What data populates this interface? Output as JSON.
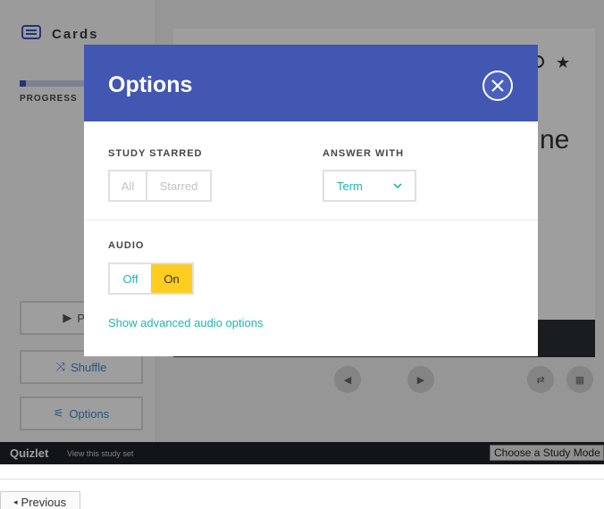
{
  "sidebar": {
    "title": "Cards",
    "progress_label": "PROGRESS",
    "progress_fraction": 0.05,
    "play_label": "Play",
    "shuffle_label": "Shuffle",
    "options_label": "Options"
  },
  "card": {
    "partial_text": "ne"
  },
  "footer": {
    "logo": "Quizlet",
    "view_link": "View this study set",
    "mode_select": "Choose a Study Mode ▾"
  },
  "modal": {
    "title": "Options",
    "study_starred": {
      "label": "STUDY STARRED",
      "options": [
        "All",
        "Starred"
      ]
    },
    "answer_with": {
      "label": "ANSWER WITH",
      "selected": "Term"
    },
    "audio": {
      "label": "AUDIO",
      "off": "Off",
      "on": "On",
      "selected": "On"
    },
    "advanced_link": "Show advanced audio options"
  },
  "page_nav": {
    "previous": "Previous"
  },
  "colors": {
    "header_blue": "#4257b2",
    "teal": "#1fb5b5",
    "audio_on": "#ffcd1f"
  }
}
